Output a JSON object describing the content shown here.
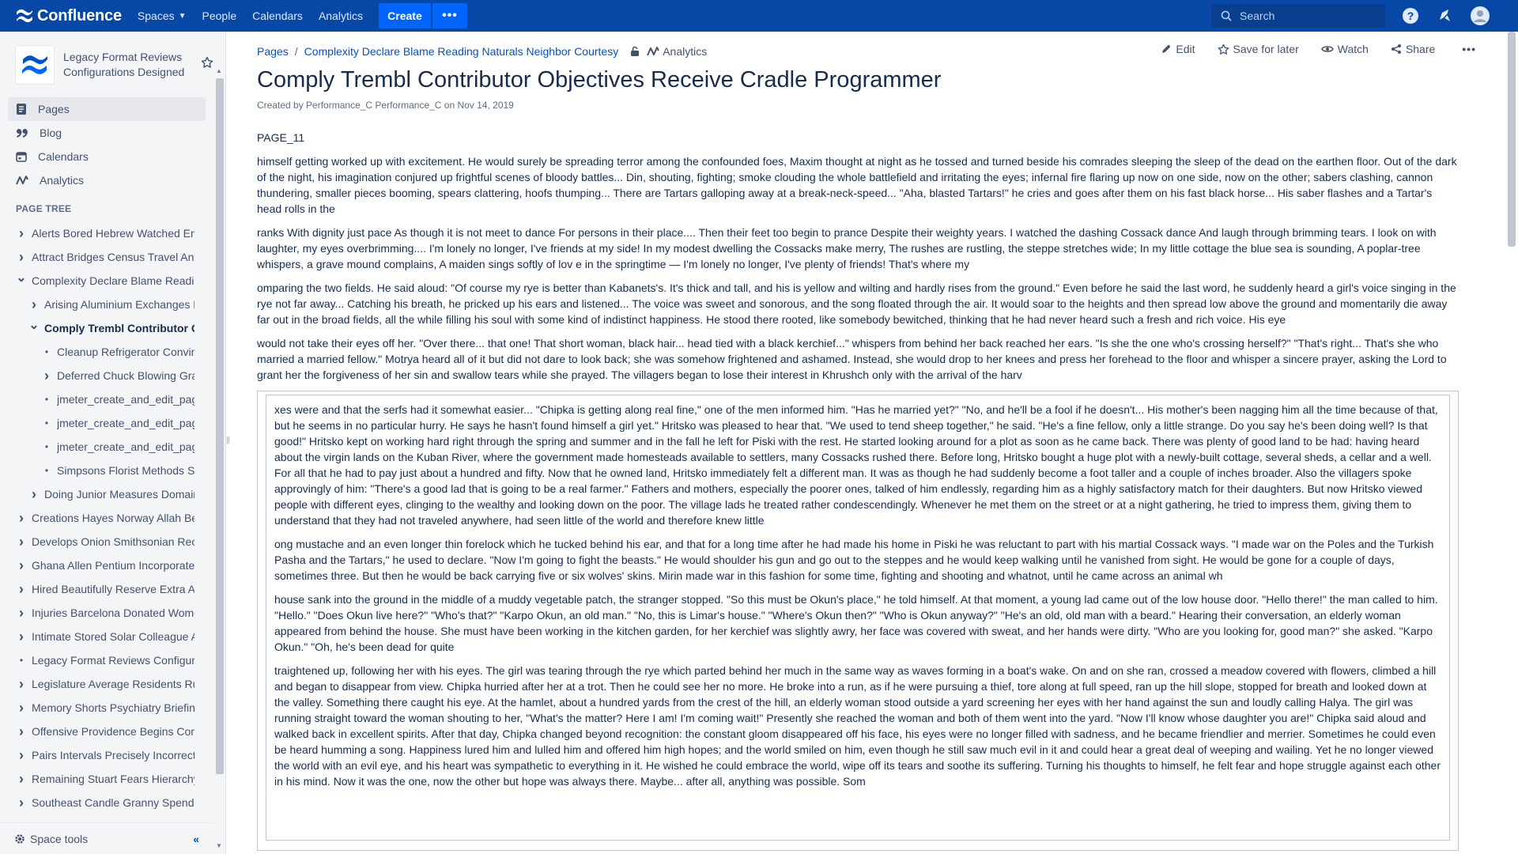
{
  "topnav": {
    "logo_text": "Confluence",
    "links": [
      {
        "label": "Spaces",
        "dropdown": true
      },
      {
        "label": "People"
      },
      {
        "label": "Calendars"
      },
      {
        "label": "Analytics"
      }
    ],
    "create_label": "Create",
    "more_label": "•••",
    "search_placeholder": "Search",
    "colors": {
      "bar": "#0747a6",
      "button": "#0065ff"
    }
  },
  "sidebar": {
    "space_name": "Legacy Format Reviews Configurations Designed",
    "nav": [
      {
        "label": "Pages",
        "icon": "pages-icon",
        "active": true
      },
      {
        "label": "Blog",
        "icon": "blog-quote-icon"
      },
      {
        "label": "Calendars",
        "icon": "calendar-icon"
      },
      {
        "label": "Analytics",
        "icon": "analytics-icon"
      }
    ],
    "tree_title": "PAGE TREE",
    "tree": [
      {
        "label": "Alerts Bored Hebrew Watched Environmental",
        "level": 0,
        "toggle": "collapsed"
      },
      {
        "label": "Attract Bridges Census Travel Antique",
        "level": 0,
        "toggle": "collapsed"
      },
      {
        "label": "Complexity Declare Blame Reading Naturals",
        "level": 0,
        "toggle": "expanded"
      },
      {
        "label": "Arising Aluminium Exchanges Payments",
        "level": 1,
        "toggle": "collapsed"
      },
      {
        "label": "Comply Trembl Contributor Objectives",
        "level": 1,
        "toggle": "expanded",
        "current": true
      },
      {
        "label": "Cleanup Refrigerator Convincing",
        "level": 2,
        "toggle": "bullet"
      },
      {
        "label": "Deferred Chuck Blowing Gratitude",
        "level": 2,
        "toggle": "collapsed"
      },
      {
        "label": "jmeter_create_and_edit_page",
        "level": 2,
        "toggle": "bullet"
      },
      {
        "label": "jmeter_create_and_edit_page",
        "level": 2,
        "toggle": "bullet"
      },
      {
        "label": "jmeter_create_and_edit_page",
        "level": 2,
        "toggle": "bullet"
      },
      {
        "label": "Simpsons Florist Methods Swiss",
        "level": 2,
        "toggle": "bullet"
      },
      {
        "label": "Doing Junior Measures Domains",
        "level": 1,
        "toggle": "collapsed"
      },
      {
        "label": "Creations Hayes Norway Allah Bedroom",
        "level": 0,
        "toggle": "collapsed"
      },
      {
        "label": "Develops Onion Smithsonian Records",
        "level": 0,
        "toggle": "collapsed"
      },
      {
        "label": "Ghana Allen Pentium Incorporate",
        "level": 0,
        "toggle": "collapsed"
      },
      {
        "label": "Hired Beautifully Reserve Extra Access",
        "level": 0,
        "toggle": "collapsed"
      },
      {
        "label": "Injuries Barcelona Donated Women",
        "level": 0,
        "toggle": "collapsed"
      },
      {
        "label": "Intimate Stored Solar Colleague Alpha",
        "level": 0,
        "toggle": "collapsed"
      },
      {
        "label": "Legacy Format Reviews Configurations",
        "level": 0,
        "toggle": "bullet"
      },
      {
        "label": "Legislature Average Residents Rules",
        "level": 0,
        "toggle": "collapsed"
      },
      {
        "label": "Memory Shorts Psychiatry Briefing",
        "level": 0,
        "toggle": "collapsed"
      },
      {
        "label": "Offensive Providence Begins Contents",
        "level": 0,
        "toggle": "collapsed"
      },
      {
        "label": "Pairs Intervals Precisely Incorrect",
        "level": 0,
        "toggle": "collapsed"
      },
      {
        "label": "Remaining Stuart Fears Hierarchy",
        "level": 0,
        "toggle": "collapsed"
      },
      {
        "label": "Southeast Candle Granny Spend",
        "level": 0,
        "toggle": "collapsed"
      }
    ],
    "space_tools_label": "Space tools",
    "collapse_label": "«"
  },
  "breadcrumb": {
    "items": [
      "Pages",
      "Complexity Declare Blame Reading Naturals Neighbor Courtesy"
    ],
    "analytics_label": "Analytics"
  },
  "page_actions": {
    "edit": "Edit",
    "save": "Save for later",
    "watch": "Watch",
    "share": "Share",
    "more": "•••"
  },
  "page": {
    "title": "Comply Trembl Contributor Objectives Receive Cradle Programmer",
    "byline_prefix": "Created by ",
    "author": "Performance_C Performance_C",
    "byline_mid": " on ",
    "date": "Nov 14, 2019",
    "paragraphs": [
      "PAGE_11",
      "himself getting worked up with excitement. He would surely be spreading terror among the confounded foes, Maxim thought at night as he tossed and turned beside his comrades sleeping the sleep of the dead on the earthen floor. Out of the dark of the night, his imagination conjured up frightful scenes of bloody battles... Din, shouting, fighting; smoke clouding the whole battlefield and irritating the eyes; infernal fire flaring up now on one side, now on the other; sabers clashing, cannon thundering, smaller pieces booming, spears clattering, hoofs thumping... There are Tartars galloping away at a break-neck-speed... \"Aha, blasted Tartars!\" he cries and goes after them on his fast black horse... His saber flashes and a Tartar's head rolls in the",
      "ranks With dignity just pace As though it is not meet to dance For persons in their place.... Then their feet too begin to prance Despite their weighty years. I watched the dashing Cossack dance And laugh through brimming tears. I look on with laughter, my eyes overbrimming.... I'm lonely no longer, I've friends at my side! In my modest dwelling the Cossacks make merry, The rushes are rustling, the steppe stretches wide; In my little cottage the blue sea is sounding, A poplar-tree whispers, a grave mound complains, A maiden sings softly of lov e in the springtime — I'm lonely no longer, I've plenty of friends! That's where my",
      "omparing the two fields. He said aloud: \"Of course my rye is better than Kabanets's. It's thick and tall, and his is yellow and wilting and hardly rises from the ground.\" Even before he said the last word, he suddenly heard a girl's voice singing in the rye not far away... Catching his breath, he pricked up his ears and listened... The voice was sweet and sonorous, and the song floated through the air. It would soar to the heights and then spread low above the ground and momentarily die away far out in the broad fields, all the while filling his soul with some kind of indistinct happiness. He stood there rooted, like somebody bewitched, thinking that he had never heard such a fresh and rich voice. His eye",
      "would not take their eyes off her. \"Over there... that one! That short woman, black hair... head tied with a black kerchief...\" whispers from behind her back reached her ears. \"Is she the one who's crossing herself?\" \"That's right... That's she who married a married fellow.\" Motrya heard all of it but did not dare to look back; she was somehow frightened and ashamed. Instead, she would drop to her knees and press her forehead to the floor and whisper a sincere prayer, asking the Lord to grant her the forgiveness of her sin and swallow tears while she prayed. The villagers began to lose their interest in Khrushch only with the arrival of the harv"
    ],
    "panel_paragraphs": [
      "xes were and that the serfs had it somewhat easier... \"Chipka is getting along real fine,\" one of the men informed him. \"Has he married yet?\" \"No, and he'll be a fool if he doesn't... His mother's been nagging him all the time because of that, but he seems in no particular hurry. He says he hasn't found himself a girl yet.\" Hritsko was pleased to hear that. \"We used to tend sheep together,\" he said. \"He's a fine fellow, only a little strange. Do you say he's been doing well? Is that good!\" Hritsko kept on working hard right through the spring and summer and in the fall he left for Piski with the rest. He started looking around for a plot as soon as he came back. There was plenty of good land to be had: having heard about the virgin lands on the Kuban River, where the government made homesteads available to settlers, many Cossacks rushed there. Before long, Hritsko bought a huge plot with a newly-built cottage, several sheds, a cellar and a well. For all that he had to pay just about a hundred and fifty. Now that he owned land, Hritsko immediately felt a different man. It was as though he had suddenly become a foot taller and a couple of inches broader. Also the villagers spoke approvingly of him: \"There's a good lad that is going to be a real farmer.\" Fathers and mothers, especially the poorer ones, talked of him endlessly, regarding him as a highly satisfactory match for their daughters. But now Hritsko viewed people with different eyes, clinging to the wealthy and looking down on the poor. The village lads he treated rather condescendingly. Whenever he met them on the street or at a night gathering, he tried to impress them, giving them to understand that they had not traveled anywhere, had seen little of the world and therefore knew little",
      "ong mustache and an even longer thin forelock which he tucked behind his ear, and that for a long time after he had made his home in Piski he was reluctant to part with his martial Cossack ways. \"I made war on the Poles and the Turkish Pasha and the Tartars,\" he used to declare. \"Now I'm going to fight the beasts.\" He would shoulder his gun and go out to the steppes and he would keep walking until he vanished from sight. He would be gone for a couple of days, sometimes three. But then he would be back carrying five or six wolves' skins. Mirin made war in this fashion for some time, fighting and shooting and whatnot, until he came across an animal wh",
      "house sank into the ground in the middle of a muddy vegetable patch, the stranger stopped. \"So this must be Okun's place,\" he told himself. At that moment, a young lad came out of the low house door. \"Hello there!\" the man called to him. \"Hello.\" \"Does Okun live here?\" \"Who's that?\" \"Karpo Okun, an old man.\" \"No, this is Limar's house.\" \"Where's Okun then?\" \"Who is Okun anyway?\" \"He's an old, old man with a beard.\" Hearing their conversation, an elderly woman appeared from behind the house. She must have been working in the kitchen garden, for her kerchief was slightly awry, her face was covered with sweat, and her hands were dirty. \"Who are you looking for, good man?\" she asked. \"Karpo Okun.\" \"Oh, he's been dead for quite",
      "traightened up, following her with his eyes. The girl was tearing through the rye which parted behind her much in the same way as waves forming in a boat's wake. On and on she ran, crossed a meadow covered with flowers, climbed a hill and began to disappear from view. Chipka hurried after her at a trot. Then he could see her no more. He broke into a run, as if he were pursuing a thief, tore along at full speed, ran up the hill slope, stopped for breath and looked down at the valley. Something there caught his eye. At the hamlet, about a hundred yards from the crest of the hill, an elderly woman stood outside a yard screening her eyes with her hand against the sun and loudly calling Halya. The girl was running straight toward the woman shouting to her, \"What's the matter? Here I am! I'm coming wait!\" Presently she reached the woman and both of them went into the yard. \"Now I'll know whose daughter you are!\" Chipka said aloud and walked back in excellent spirits. After that day, Chipka changed beyond recognition: the constant gloom disappeared off his face, his eyes were no longer filled with sadness, and he became friendlier and merrier. Sometimes he could even be heard humming a song. Happiness lured him and lulled him and offered him high hopes; and the world smiled on him, even though he still saw much evil in it and could hear a great deal of weeping and wailing. Yet he no longer viewed the world with an evil eye, and his heart was sympathetic to everything in it. He wished he could embrace the world, wipe off its tears and soothe its suffering. Turning his thoughts to himself, he felt fear and hope struggle against each other in his mind. Now it was the one, now the other but hope was always there. Maybe... after all, anything was possible. Som"
    ]
  }
}
